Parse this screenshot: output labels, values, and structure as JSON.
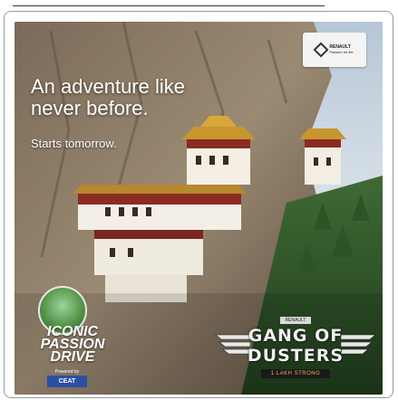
{
  "ad": {
    "headline_line1": "An adventure like",
    "headline_line2": "never before.",
    "subline": "Starts tomorrow.",
    "renault": {
      "brand": "RENAULT",
      "tagline": "Passion for life"
    },
    "iconic_passion_drive": {
      "line1": "ICONIC",
      "line2": "PASSION",
      "line3": "DRIVE",
      "powered_by": "Powered by",
      "sponsor": "CEAT"
    },
    "gang_of_dusters": {
      "brand_small": "RENAULT",
      "line1": "GANG OF",
      "line2": "DUSTERS",
      "strap": "1 LAKH STRONG"
    }
  },
  "colors": {
    "headline_text": "#ffffff",
    "card_border": "#9a9a9a",
    "ceat_blue": "#2b4fa3",
    "strap_gold": "#e0b84a"
  }
}
